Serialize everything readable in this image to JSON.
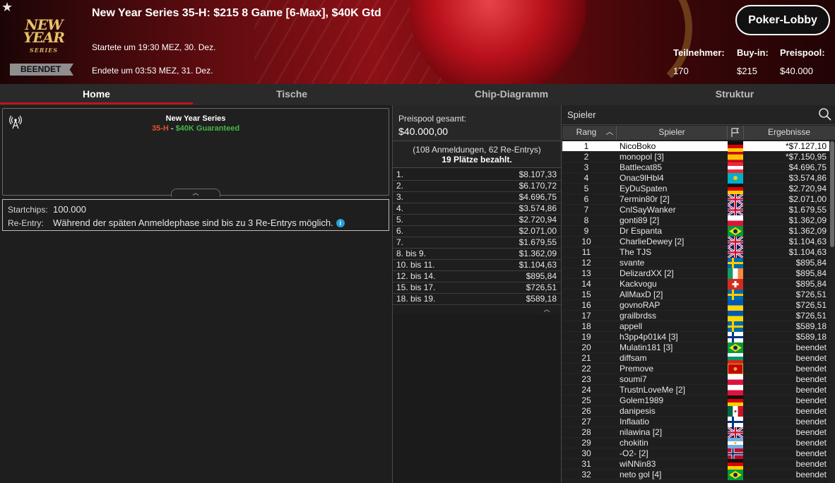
{
  "header": {
    "title": "New Year Series 35-H: $215 8 Game [6-Max], $40K Gtd",
    "logo_line1": "NEW YEAR",
    "logo_line2": "SERIES",
    "status": "BEENDET",
    "started": "Startete um 19:30 MEZ, 30. Dez.",
    "ended": "Endete um 03:53 MEZ, 31. Dez.",
    "lobby_button": "Poker-Lobby",
    "stats": [
      {
        "label": "Teilnehmer:",
        "value": "170"
      },
      {
        "label": "Buy-in:",
        "value": "$215"
      },
      {
        "label": "Preispool:",
        "value": "$40.000"
      }
    ]
  },
  "tabs": [
    {
      "label": "Home",
      "active": true
    },
    {
      "label": "Tische",
      "active": false
    },
    {
      "label": "Chip-Diagramm",
      "active": false
    },
    {
      "label": "Struktur",
      "active": false
    }
  ],
  "info": {
    "series_name": "New Year Series",
    "event_code": "35-H",
    "separator": " - ",
    "guarantee": "$40K Guaranteed",
    "startchips_label": "Startchips:",
    "startchips_value": "100.000",
    "reentry_label": "Re-Entry:",
    "reentry_value": "Während der späten Anmeldephase sind bis zu 3 Re-Entrys möglich.",
    "info_icon": "i"
  },
  "prizepool": {
    "label": "Preispool gesamt:",
    "total": "$40.000,00",
    "entries": "(108 Anmeldungen, 62 Re-Entrys)",
    "paid": "19 Plätze bezahlt.",
    "payouts": [
      {
        "place": "1.",
        "amount": "$8.107,33"
      },
      {
        "place": "2.",
        "amount": "$6.170,72"
      },
      {
        "place": "3.",
        "amount": "$4.696,75"
      },
      {
        "place": "4.",
        "amount": "$3.574,86"
      },
      {
        "place": "5.",
        "amount": "$2.720,94"
      },
      {
        "place": "6.",
        "amount": "$2.071,00"
      },
      {
        "place": "7.",
        "amount": "$1.679,55"
      },
      {
        "place": "8. bis 9.",
        "amount": "$1.362,09"
      },
      {
        "place": "10. bis 11.",
        "amount": "$1.104,63"
      },
      {
        "place": "12. bis 14.",
        "amount": "$895,84"
      },
      {
        "place": "15. bis 17.",
        "amount": "$726,51"
      },
      {
        "place": "18. bis 19.",
        "amount": "$589,18"
      }
    ]
  },
  "players": {
    "search_label": "Spieler",
    "columns": {
      "rank": "Rang",
      "player": "Spieler",
      "results": "Ergebnisse"
    },
    "rows": [
      {
        "rank": "1",
        "name": "NicoBoko",
        "flag": "de",
        "result": "*$7.127,10"
      },
      {
        "rank": "2",
        "name": "monopol [3]",
        "flag": "es",
        "result": "*$7.150,95"
      },
      {
        "rank": "3",
        "name": "Battlecat85",
        "flag": "at",
        "result": "$4.696,75"
      },
      {
        "rank": "4",
        "name": "Onac9lHbl4",
        "flag": "kz",
        "result": "$3.574,86"
      },
      {
        "rank": "5",
        "name": "EyDuSpaten",
        "flag": "de",
        "result": "$2.720,94"
      },
      {
        "rank": "6",
        "name": "7ermin80r [2]",
        "flag": "gb",
        "result": "$2.071,00"
      },
      {
        "rank": "7",
        "name": "CnlSayWanker",
        "flag": "gb",
        "result": "$1.679,55"
      },
      {
        "rank": "8",
        "name": "gonti89 [2]",
        "flag": "pl",
        "result": "$1.362,09"
      },
      {
        "rank": "9",
        "name": "Dr Espanta",
        "flag": "br",
        "result": "$1.362,09"
      },
      {
        "rank": "10",
        "name": "CharlieDewey [2]",
        "flag": "gb",
        "result": "$1.104,63"
      },
      {
        "rank": "11",
        "name": "The TJS",
        "flag": "gb",
        "result": "$1.104,63"
      },
      {
        "rank": "12",
        "name": "svante",
        "flag": "se",
        "result": "$895,84"
      },
      {
        "rank": "13",
        "name": "DelizardXX [2]",
        "flag": "ie",
        "result": "$895,84"
      },
      {
        "rank": "14",
        "name": "Kackvogu",
        "flag": "ch",
        "result": "$895,84"
      },
      {
        "rank": "15",
        "name": "AllMaxD [2]",
        "flag": "se",
        "result": "$726,51"
      },
      {
        "rank": "16",
        "name": "govnoRAP",
        "flag": "ua",
        "result": "$726,51"
      },
      {
        "rank": "17",
        "name": "grailbrdss",
        "flag": "ua",
        "result": "$726,51"
      },
      {
        "rank": "18",
        "name": "appell",
        "flag": "se",
        "result": "$589,18"
      },
      {
        "rank": "19",
        "name": "h3pp4p01k4 [3]",
        "flag": "fi",
        "result": "$589,18"
      },
      {
        "rank": "20",
        "name": "Mulatin181 [3]",
        "flag": "br",
        "result": "beendet"
      },
      {
        "rank": "21",
        "name": "diffsam",
        "flag": "bg",
        "result": "beendet"
      },
      {
        "rank": "22",
        "name": "Premove",
        "flag": "me",
        "result": "beendet"
      },
      {
        "rank": "23",
        "name": "soumi7",
        "flag": "pl",
        "result": "beendet"
      },
      {
        "rank": "24",
        "name": "TrustnLoveMe [2]",
        "flag": "pl",
        "result": "beendet"
      },
      {
        "rank": "25",
        "name": "Golem1989",
        "flag": "de",
        "result": "beendet"
      },
      {
        "rank": "26",
        "name": "danipesis",
        "flag": "mx",
        "result": "beendet"
      },
      {
        "rank": "27",
        "name": "Inflaatio",
        "flag": "fi",
        "result": "beendet"
      },
      {
        "rank": "28",
        "name": "nilawina [2]",
        "flag": "gb",
        "result": "beendet"
      },
      {
        "rank": "29",
        "name": "chokitin",
        "flag": "ar",
        "result": "beendet"
      },
      {
        "rank": "30",
        "name": "-O2- [2]",
        "flag": "no",
        "result": "beendet"
      },
      {
        "rank": "31",
        "name": "wiNNin83",
        "flag": "de",
        "result": "beendet"
      },
      {
        "rank": "32",
        "name": "neto gol [4]",
        "flag": "br",
        "result": "beendet"
      }
    ]
  },
  "colors": {
    "accent_red": "#c0141c",
    "event_code": "#e0542a",
    "guarantee_green": "#47b548",
    "info_blue": "#2aa0d8"
  }
}
